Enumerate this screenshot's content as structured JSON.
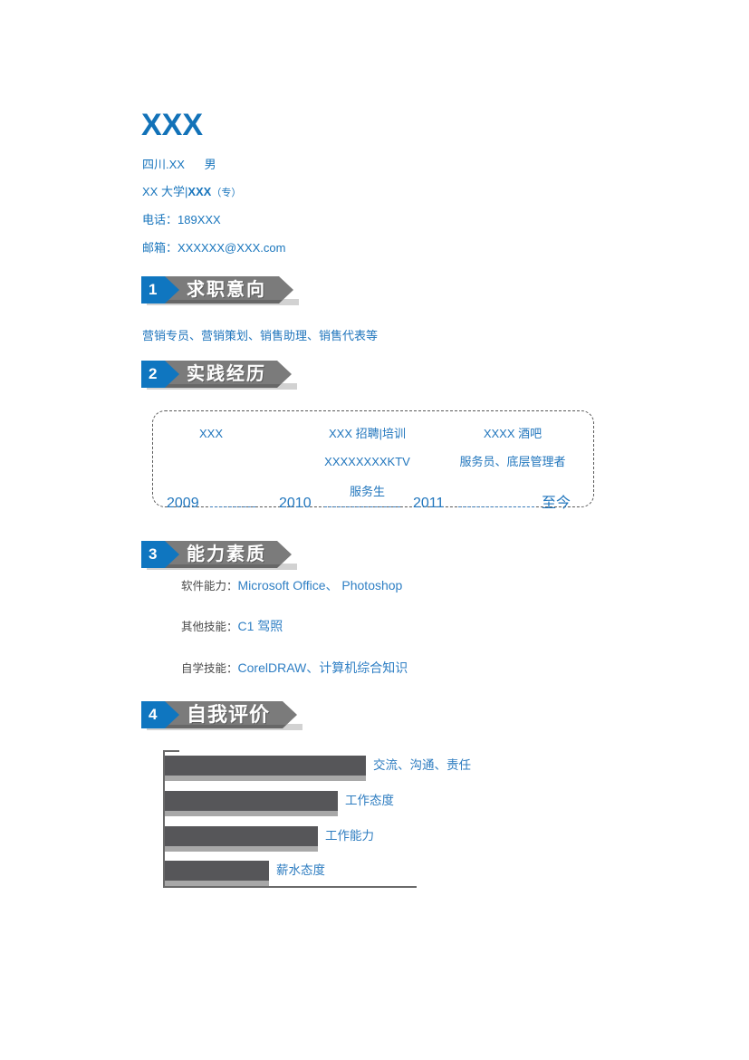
{
  "document": {
    "type": "resume",
    "name": "XXX"
  },
  "header": {
    "name": "XXX",
    "line1": "四川.XX      男",
    "line2_prefix": "XX 大学|",
    "line2_bold": "XXX",
    "line2_suffix": "（专）",
    "line3": "电话：189XXX",
    "line4": "邮箱：XXXXXX@XXX.com"
  },
  "colors": {
    "accent_blue": "#1272b8",
    "text_blue": "#2176bd",
    "badge_blue": "#0f76c0",
    "banner_gray": "#7b7b7b",
    "banner_shadow": "#d2d2d2",
    "bar_dark": "#565659",
    "bar_shadow": "#a8a8a8",
    "axis_gray": "#6a6a6a"
  },
  "sections": [
    {
      "number": "1",
      "label": "求职意向"
    },
    {
      "number": "2",
      "label": "实践经历"
    },
    {
      "number": "3",
      "label": "能力素质"
    },
    {
      "number": "4",
      "label": "自我评价"
    }
  ],
  "job_objective": {
    "text": "营销专员、营销策划、销售助理、销售代表等"
  },
  "experience": {
    "entries": [
      {
        "company": "XXX",
        "role": ""
      },
      {
        "company": "XXX 招聘|培训",
        "company2": "XXXXXXXXKTV",
        "role": "服务生"
      },
      {
        "company": "XXXX 酒吧",
        "role": "服务员、底层管理者"
      }
    ],
    "cells": {
      "c1_r1": "XXX",
      "c2_r1": "XXX 招聘|培训",
      "c2_r2": "XXXXXXXXKTV",
      "c2_r3": "服务生",
      "c3_r1": "XXXX 酒吧",
      "c3_r2": "服务员、底层管理者"
    },
    "timeline": [
      "2009",
      "2010",
      "2011",
      "至今"
    ]
  },
  "skills": {
    "rows": [
      {
        "label": "软件能力：",
        "value": "Microsoft Office、 Photoshop"
      },
      {
        "label": "其他技能：",
        "value": "C1 驾照"
      },
      {
        "label": "自学技能：",
        "value": "CorelDRAW、计算机综合知识"
      }
    ]
  },
  "chart_data": {
    "type": "bar",
    "orientation": "horizontal",
    "title": "自我评价",
    "categories": [
      "交流、沟通、责任",
      "工作态度",
      "工作能力",
      "薪水态度"
    ],
    "values": [
      100,
      86,
      76,
      52
    ],
    "xlabel": "",
    "ylabel": "",
    "xlim": [
      0,
      100
    ],
    "grid": false,
    "legend": false,
    "bar_color": "#565659",
    "shadow_color": "#a8a8a8",
    "label_color": "#2d7cc0"
  }
}
